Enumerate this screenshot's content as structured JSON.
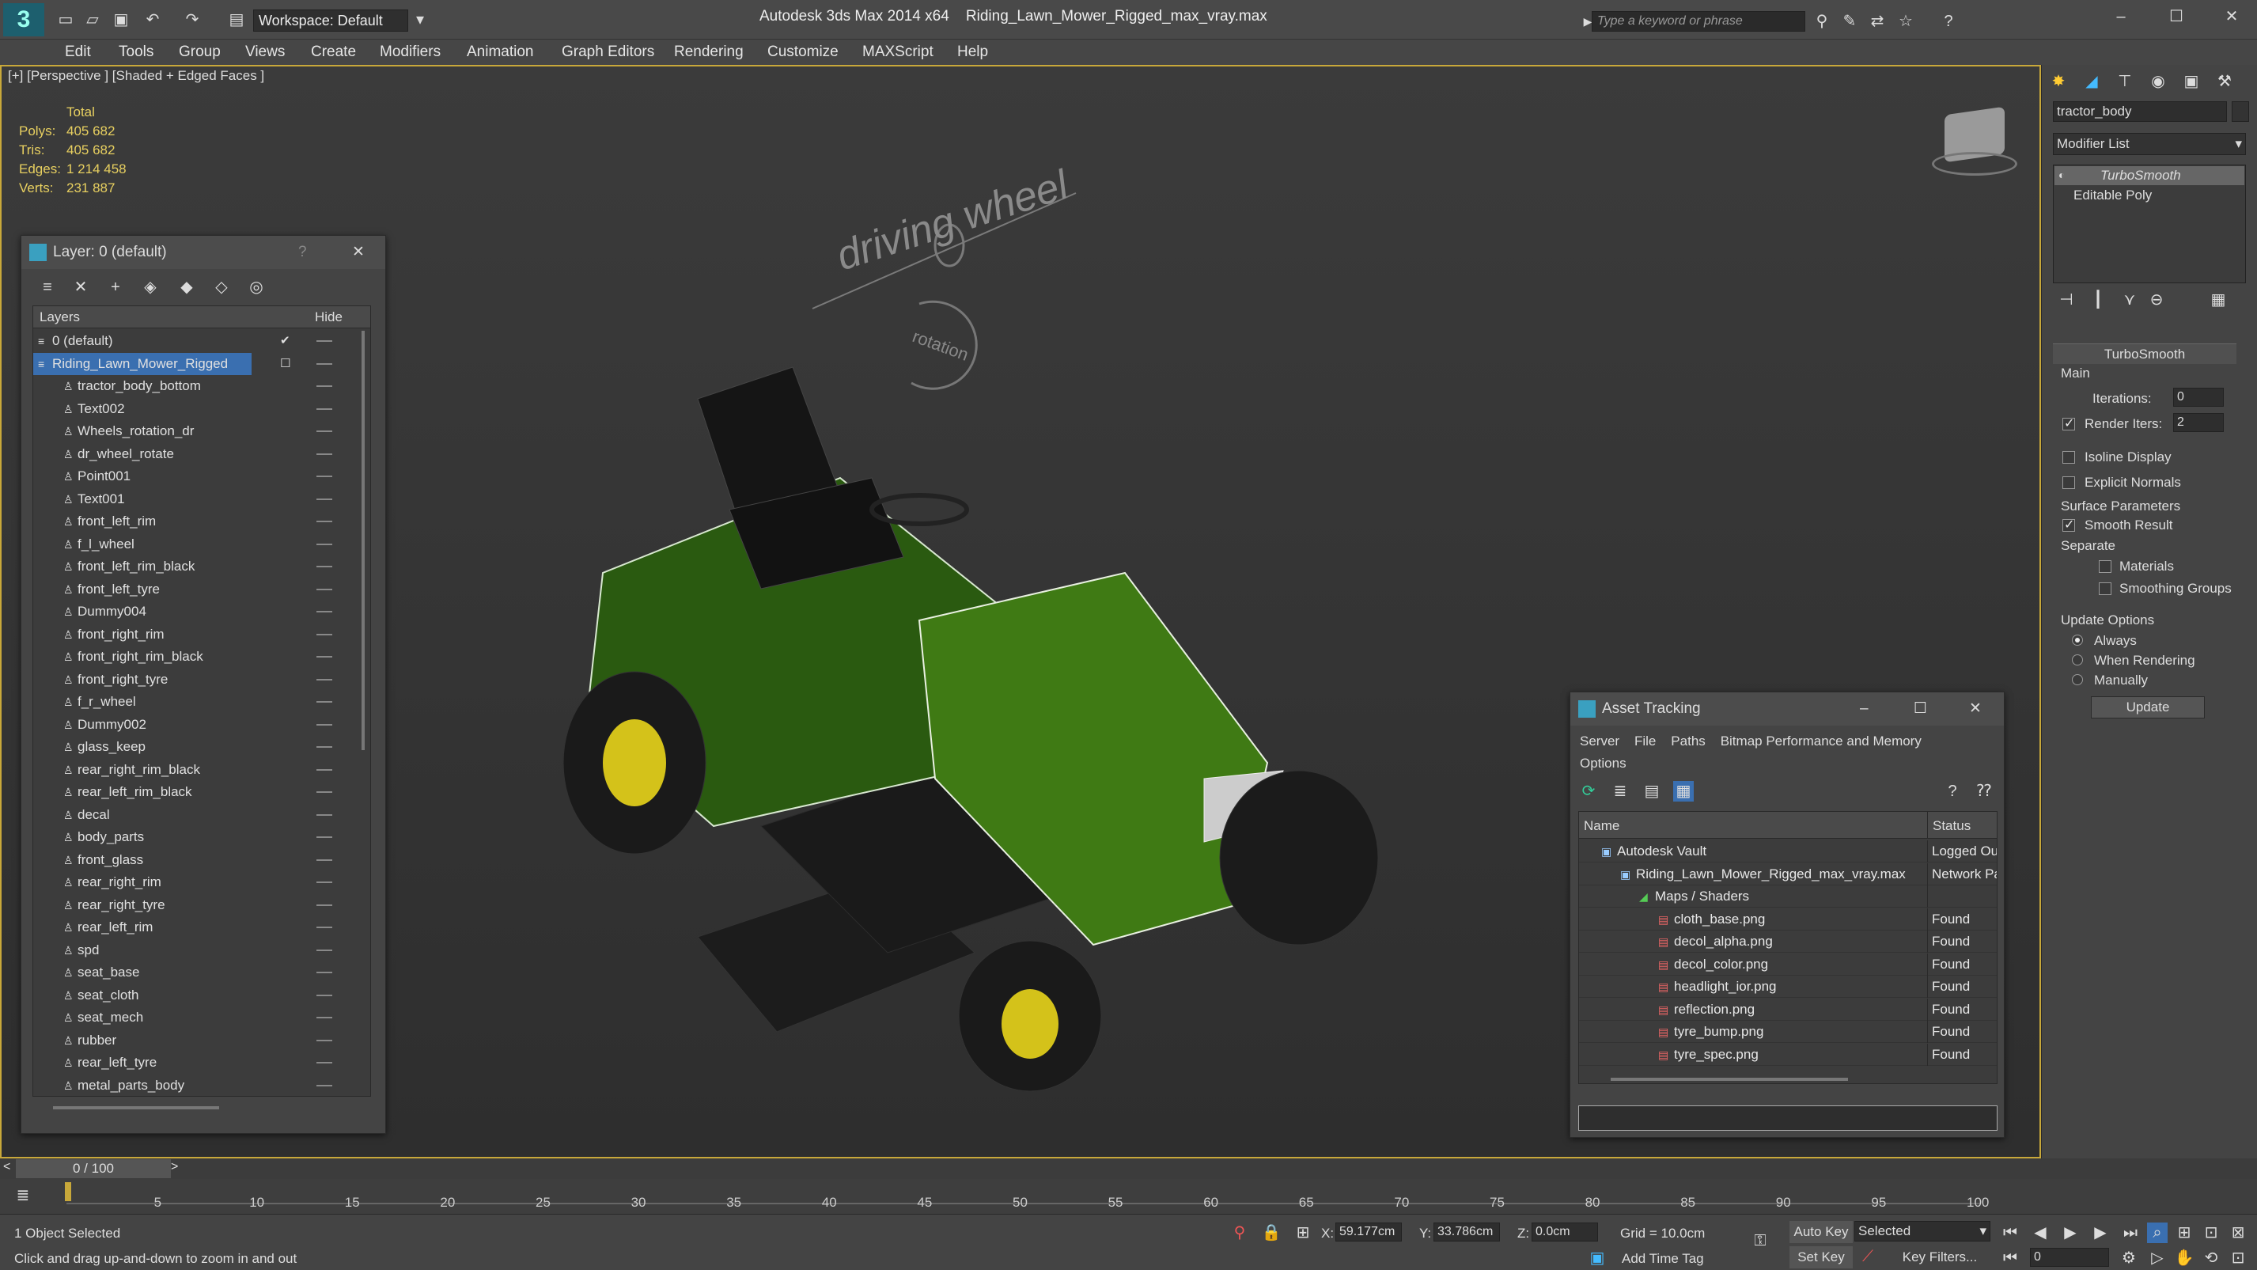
{
  "app": {
    "title": "Autodesk 3ds Max  2014 x64",
    "file": "Riding_Lawn_Mower_Rigged_max_vray.max",
    "workspace": "Workspace: Default",
    "search_placeholder": "Type a keyword or phrase"
  },
  "menu": [
    "Edit",
    "Tools",
    "Group",
    "Views",
    "Create",
    "Modifiers",
    "Animation",
    "Graph Editors",
    "Rendering",
    "Customize",
    "MAXScript",
    "Help"
  ],
  "viewport": {
    "label": "[+] [Perspective ] [Shaded + Edged Faces ]",
    "text_driving": "driving wheel",
    "text_rotation": "rotation",
    "stats": {
      "header": "Total",
      "rows": [
        {
          "k": "Polys:",
          "v": "405 682"
        },
        {
          "k": "Tris:",
          "v": "405 682"
        },
        {
          "k": "Edges:",
          "v": "1 214 458"
        },
        {
          "k": "Verts:",
          "v": "231 887"
        }
      ]
    }
  },
  "layer_panel": {
    "title": "Layer: 0 (default)",
    "help": "?",
    "col_layers": "Layers",
    "col_hide": "Hide",
    "layers": [
      "0 (default)",
      "Riding_Lawn_Mower_Rigged",
      "tractor_body_bottom",
      "Text002",
      "Wheels_rotation_dr",
      "dr_wheel_rotate",
      "Point001",
      "Text001",
      "front_left_rim",
      "f_l_wheel",
      "front_left_rim_black",
      "front_left_tyre",
      "Dummy004",
      "front_right_rim",
      "front_right_rim_black",
      "front_right_tyre",
      "f_r_wheel",
      "Dummy002",
      "glass_keep",
      "rear_right_rim_black",
      "rear_left_rim_black",
      "decal",
      "body_parts",
      "front_glass",
      "rear_right_rim",
      "rear_right_tyre",
      "rear_left_rim",
      "spd",
      "seat_base",
      "seat_cloth",
      "seat_mech",
      "rubber",
      "rear_left_tyre",
      "metal_parts_body"
    ]
  },
  "asset_panel": {
    "title": "Asset Tracking",
    "menus": [
      "Server",
      "File",
      "Paths",
      "Bitmap Performance and Memory",
      "Options"
    ],
    "col_name": "Name",
    "col_status": "Status",
    "rows": [
      {
        "name": "Autodesk Vault",
        "status": "Logged Ou",
        "indent": 1
      },
      {
        "name": "Riding_Lawn_Mower_Rigged_max_vray.max",
        "status": "Network Pa",
        "indent": 2
      },
      {
        "name": "Maps / Shaders",
        "status": "",
        "indent": 3
      },
      {
        "name": "cloth_base.png",
        "status": "Found",
        "indent": 4
      },
      {
        "name": "decol_alpha.png",
        "status": "Found",
        "indent": 4
      },
      {
        "name": "decol_color.png",
        "status": "Found",
        "indent": 4
      },
      {
        "name": "headlight_ior.png",
        "status": "Found",
        "indent": 4
      },
      {
        "name": "reflection.png",
        "status": "Found",
        "indent": 4
      },
      {
        "name": "tyre_bump.png",
        "status": "Found",
        "indent": 4
      },
      {
        "name": "tyre_spec.png",
        "status": "Found",
        "indent": 4
      }
    ]
  },
  "command_panel": {
    "object_name": "tractor_body",
    "modifier_list": "Modifier List",
    "stack": [
      "TurboSmooth",
      "Editable Poly"
    ],
    "rollout": "TurboSmooth",
    "main": "Main",
    "iterations_label": "Iterations:",
    "iterations": "0",
    "render_iters_label": "Render Iters:",
    "render_iters": "2",
    "isoline": "Isoline Display",
    "explicit": "Explicit Normals",
    "surface": "Surface Parameters",
    "smooth": "Smooth Result",
    "separate": "Separate",
    "materials": "Materials",
    "smoothing": "Smoothing Groups",
    "update_opts": "Update Options",
    "always": "Always",
    "when_rendering": "When Rendering",
    "manually": "Manually",
    "update_btn": "Update"
  },
  "timeline": {
    "frame": "0 / 100",
    "ticks": [
      "5",
      "10",
      "15",
      "20",
      "25",
      "30",
      "35",
      "40",
      "45",
      "50",
      "55",
      "60",
      "65",
      "70",
      "75",
      "80",
      "85",
      "90",
      "95",
      "100"
    ],
    "ticks_pos": [
      5,
      10,
      15,
      20,
      25,
      30,
      35,
      40,
      45,
      50,
      55,
      60,
      65,
      70,
      75,
      80,
      85,
      90,
      95,
      100
    ]
  },
  "status": {
    "selected": "1 Object Selected",
    "hint": "Click and drag up-and-down to zoom in and out",
    "x_label": "X:",
    "x": "59.177cm",
    "y_label": "Y:",
    "y": "33.786cm",
    "z_label": "Z:",
    "z": "0.0cm",
    "grid": "Grid = 10.0cm",
    "autokey": "Auto Key",
    "setkey": "Set Key",
    "selected_dd": "Selected",
    "keyfilters": "Key Filters...",
    "addtimetag": "Add Time Tag",
    "frame_field": "0"
  }
}
